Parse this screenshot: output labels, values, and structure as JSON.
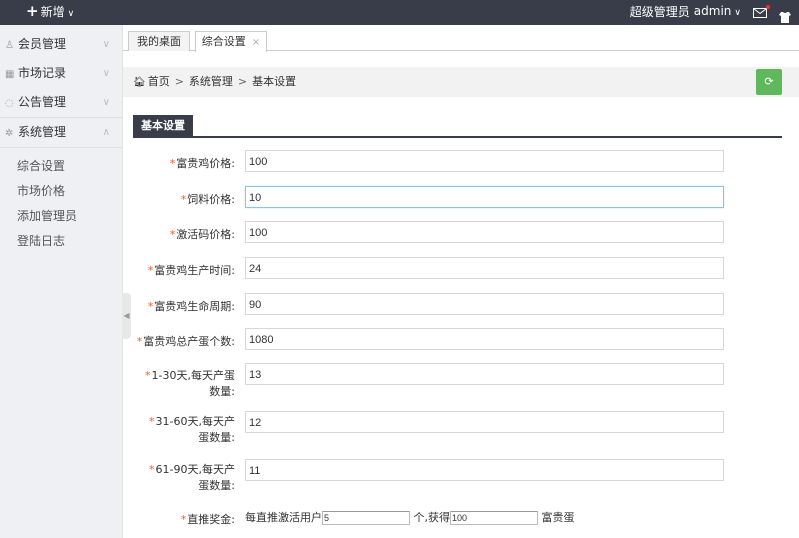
{
  "topbar": {
    "add_label": "新增",
    "role": "超级管理员",
    "user": "admin"
  },
  "sidebar": {
    "items": [
      {
        "label": "会员管理",
        "icon": "user-icon"
      },
      {
        "label": "市场记录",
        "icon": "building-icon"
      },
      {
        "label": "公告管理",
        "icon": "speech-icon"
      },
      {
        "label": "系统管理",
        "icon": "gear-icon"
      }
    ],
    "subitems": [
      "综合设置",
      "市场价格",
      "添加管理员",
      "登陆日志"
    ]
  },
  "tabs": [
    {
      "label": "我的桌面"
    },
    {
      "label": "综合设置",
      "close": "×"
    }
  ],
  "breadcrumb": {
    "home": "首页",
    "separator": ">",
    "level1": "系统管理",
    "level2": "基本设置"
  },
  "section": {
    "title": "基本设置"
  },
  "form": {
    "required_mark": "*",
    "fields": [
      {
        "label": "富贵鸡价格:",
        "value": "100"
      },
      {
        "label": "饲料价格:",
        "value": "10"
      },
      {
        "label": "激活码价格:",
        "value": "100"
      },
      {
        "label": "富贵鸡生产时间:",
        "value": "24"
      },
      {
        "label": "富贵鸡生命周期:",
        "value": "90"
      },
      {
        "label": "富贵鸡总产蛋个数:",
        "value": "1080"
      },
      {
        "label": "1-30天,每天产蛋数量:",
        "value": "13"
      },
      {
        "label": "31-60天,每天产蛋数量:",
        "value": "12"
      },
      {
        "label": "61-90天,每天产蛋数量:",
        "value": "11"
      }
    ],
    "reward": {
      "label": "直推奖金:",
      "prefix": "每直推激活用户",
      "count": "5",
      "middle": "个,获得",
      "amount": "100",
      "suffix": "富贵蛋"
    }
  },
  "colors": {
    "topbar": "#393d49",
    "accent_green": "#5fb85c",
    "required": "#ff5722"
  }
}
